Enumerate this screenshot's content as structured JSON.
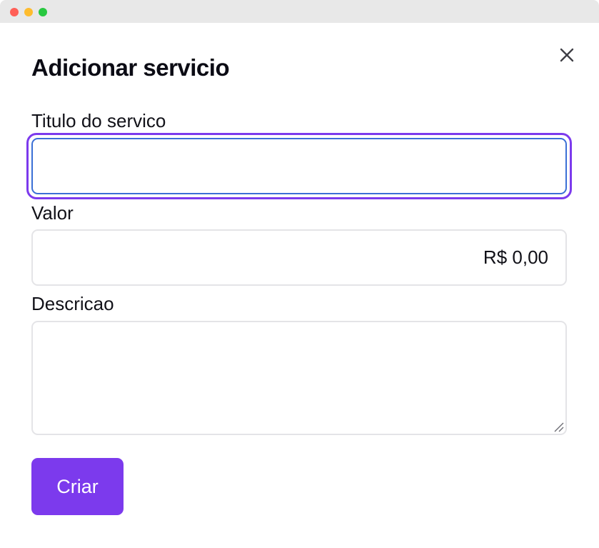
{
  "modal": {
    "title": "Adicionar servicio",
    "close_icon": "close-icon"
  },
  "form": {
    "titulo": {
      "label": "Titulo do servico",
      "value": "",
      "placeholder": "",
      "focused": true
    },
    "valor": {
      "label": "Valor",
      "value": "R$ 0,00"
    },
    "descricao": {
      "label": "Descricao",
      "value": ""
    },
    "submit_label": "Criar"
  },
  "colors": {
    "accent": "#7c3aed",
    "focus_border": "#3b6fd6",
    "input_border": "#e4e4e7",
    "text": "#111118"
  }
}
